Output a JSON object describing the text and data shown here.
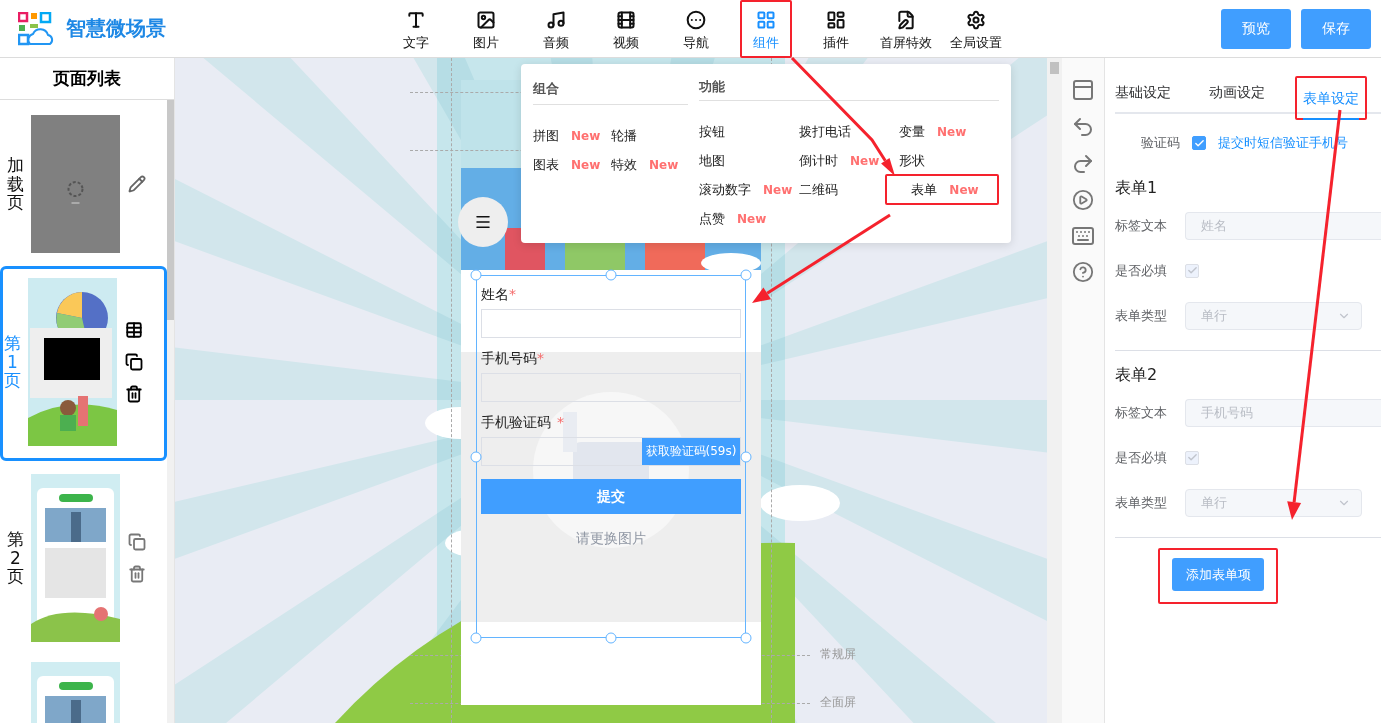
{
  "app": {
    "title": "智慧微场景"
  },
  "toolbar": [
    {
      "label": "文字",
      "selected": false,
      "annotated": false
    },
    {
      "label": "图片",
      "selected": false,
      "annotated": false
    },
    {
      "label": "音频",
      "selected": false,
      "annotated": false
    },
    {
      "label": "视频",
      "selected": false,
      "annotated": false
    },
    {
      "label": "导航",
      "selected": false,
      "annotated": false
    },
    {
      "label": "组件",
      "selected": true,
      "annotated": true
    },
    {
      "label": "插件",
      "selected": false,
      "annotated": false
    },
    {
      "label": "首屏特效",
      "selected": false,
      "annotated": false
    },
    {
      "label": "全局设置",
      "selected": false,
      "annotated": false
    }
  ],
  "header_buttons": [
    "预览",
    "保存"
  ],
  "page_list": {
    "title": "页面列表",
    "pages": [
      {
        "kind": "loading",
        "label": "加载页",
        "selected": false
      },
      {
        "kind": "page",
        "label": "第1页",
        "selected": true
      },
      {
        "kind": "page",
        "label": "第2页",
        "selected": false
      },
      {
        "kind": "page",
        "selected": false
      }
    ]
  },
  "component_menu": {
    "groups": [
      {
        "title": "组合",
        "kind": "pair",
        "items": [
          {
            "label": "拼图",
            "badge": "New",
            "annotated": false
          },
          {
            "label": "轮播",
            "annotated": false
          },
          {
            "label": "图表",
            "badge": "New",
            "annotated": false
          },
          {
            "label": "特效",
            "badge": "New",
            "annotated": false
          }
        ]
      },
      {
        "title": "功能",
        "kind": "triple",
        "items": [
          {
            "label": "按钮",
            "annotated": false
          },
          {
            "label": "拨打电话",
            "annotated": false
          },
          {
            "label": "变量",
            "badge": "New",
            "annotated": false
          },
          {
            "label": "地图",
            "annotated": false
          },
          {
            "label": "倒计时",
            "badge": "New",
            "annotated": false
          },
          {
            "label": "形状",
            "annotated": false
          },
          {
            "label": "滚动数字",
            "badge": "New",
            "annotated": false
          },
          {
            "label": "二维码",
            "annotated": false
          },
          {
            "label": "表单",
            "badge": "New",
            "annotated": true
          },
          {
            "label": "点赞",
            "badge": "New",
            "annotated": false
          }
        ]
      }
    ]
  },
  "canvas": {
    "image_placeholder": "请更换图片",
    "guides": [
      "常规屏",
      "全面屏"
    ]
  },
  "form": {
    "fields": [
      {
        "kind": "text",
        "label": "姓名",
        "mark": "*"
      },
      {
        "kind": "text",
        "label": "手机号码",
        "mark": "*"
      },
      {
        "kind": "code",
        "label": "手机验证码",
        "mark": "*",
        "button": "获取验证码(59s)"
      }
    ],
    "submit": "提交"
  },
  "settings": {
    "tabs": [
      {
        "label": "基础设定",
        "selected": false,
        "annotated": false
      },
      {
        "label": "动画设定",
        "selected": false,
        "annotated": false
      },
      {
        "label": "表单设定",
        "selected": true,
        "annotated": true
      }
    ],
    "verification": {
      "label": "验证码",
      "checked": true,
      "text": "提交时短信验证手机号"
    },
    "forms": [
      {
        "title": "表单1",
        "label_caption": "标签文本",
        "label_placeholder": "姓名",
        "required_caption": "是否必填",
        "required": true,
        "disabled": true,
        "type_caption": "表单类型",
        "type_value": "单行"
      },
      {
        "title": "表单2",
        "label_caption": "标签文本",
        "label_placeholder": "手机号码",
        "required_caption": "是否必填",
        "required": true,
        "disabled": true,
        "type_caption": "表单类型",
        "type_value": "单行"
      }
    ],
    "add_button": {
      "label": "添加表单项",
      "annotated": true
    }
  }
}
